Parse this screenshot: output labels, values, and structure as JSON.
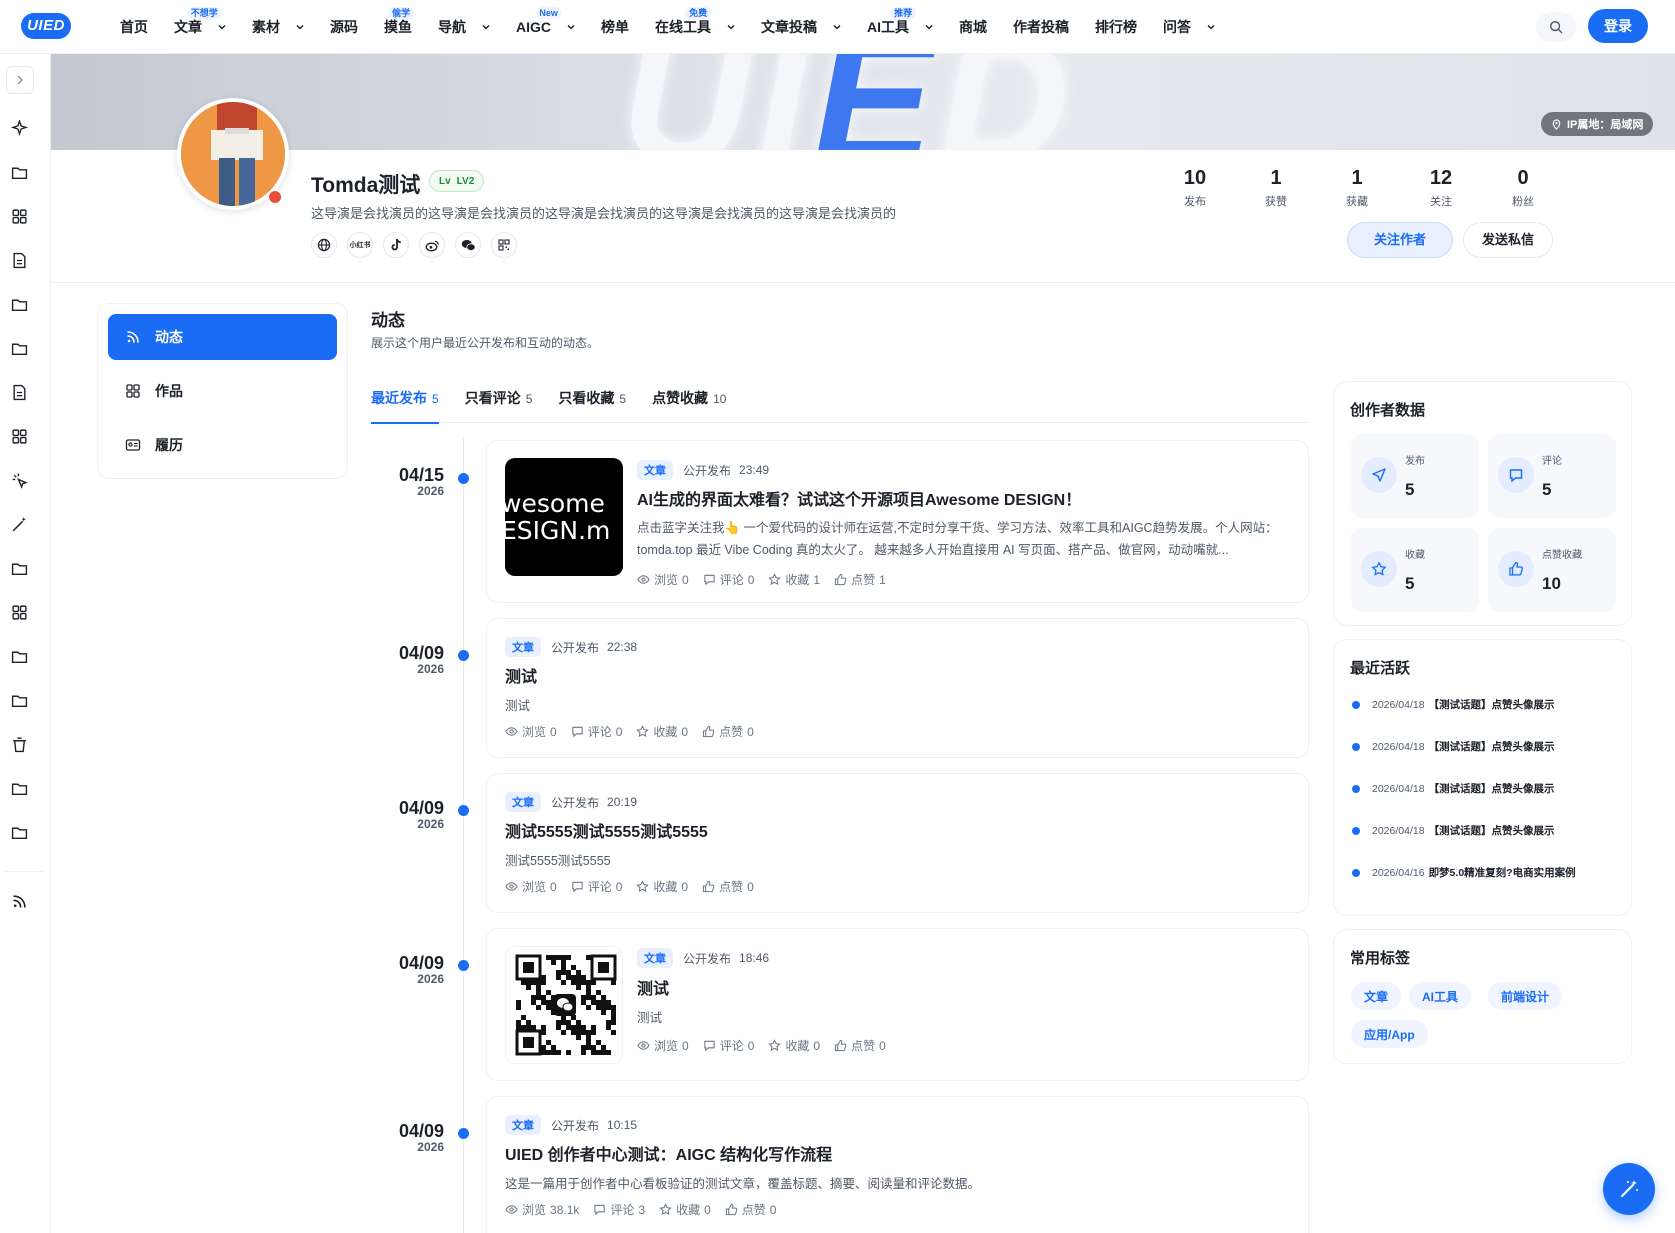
{
  "header": {
    "logo": "UIED",
    "nav": [
      {
        "label": "首页",
        "badge": "",
        "dropdown": false
      },
      {
        "label": "文章",
        "badge": "不想学",
        "dropdown": true
      },
      {
        "label": "素材",
        "badge": "",
        "dropdown": true
      },
      {
        "label": "源码",
        "badge": "",
        "dropdown": false
      },
      {
        "label": "摸鱼",
        "badge": "偷学",
        "dropdown": false
      },
      {
        "label": "导航",
        "badge": "",
        "dropdown": true
      },
      {
        "label": "AIGC",
        "badge": "New",
        "dropdown": true
      },
      {
        "label": "榜单",
        "badge": "",
        "dropdown": false
      },
      {
        "label": "在线工具",
        "badge": "免费",
        "dropdown": true
      },
      {
        "label": "文章投稿",
        "badge": "",
        "dropdown": true
      },
      {
        "label": "AI工具",
        "badge": "推荐",
        "dropdown": true
      },
      {
        "label": "商城",
        "badge": "",
        "dropdown": false
      },
      {
        "label": "作者投稿",
        "badge": "",
        "dropdown": false
      },
      {
        "label": "排行榜",
        "badge": "",
        "dropdown": false
      },
      {
        "label": "问答",
        "badge": "",
        "dropdown": true
      }
    ],
    "login_label": "登录"
  },
  "banner": {
    "word_left": "UI",
    "word_mid": "E",
    "word_right": "D",
    "ip_label": "IP属地：局域网"
  },
  "profile": {
    "name": "Tomda测试",
    "level_prefix": "Lv",
    "level": "LV2",
    "bio": "这导演是会找演员的这导演是会找演员的这导演是会找演员的这导演是会找演员的这导演是会找演员的",
    "social_xhs": "小红书",
    "stats": [
      {
        "value": "10",
        "label": "发布"
      },
      {
        "value": "1",
        "label": "获赞"
      },
      {
        "value": "1",
        "label": "获藏"
      },
      {
        "value": "12",
        "label": "关注"
      },
      {
        "value": "0",
        "label": "粉丝"
      }
    ],
    "follow_label": "关注作者",
    "message_label": "发送私信"
  },
  "side_menu": {
    "items": [
      {
        "label": "动态",
        "icon": "rss-icon",
        "active": true
      },
      {
        "label": "作品",
        "icon": "grid-icon",
        "active": false
      },
      {
        "label": "履历",
        "icon": "id-card-icon",
        "active": false
      }
    ]
  },
  "main": {
    "title": "动态",
    "subtitle": "展示这个用户最近公开发布和互动的动态。",
    "tabs": [
      {
        "label": "最近发布",
        "count": "5",
        "active": true
      },
      {
        "label": "只看评论",
        "count": "5",
        "active": false
      },
      {
        "label": "只看收藏",
        "count": "5",
        "active": false
      },
      {
        "label": "点赞收藏",
        "count": "10",
        "active": false
      }
    ],
    "feed": [
      {
        "date": "04/15",
        "year": "2026",
        "tag": "文章",
        "pub": "公开发布",
        "time": "23:49",
        "title": "AI生成的界面太难看？试试这个开源项目Awesome DESIGN！",
        "excerpt": "点击蓝字关注我👆 一个爱代码的设计师在运营,不定时分享干货、学习方法、效率工具和AIGC趋势发展。个人网站：tomda.top 最近 Vibe Coding 真的太火了。 越来越多人开始直接用 AI 写页面、搭产品、做官网，动动嘴就...",
        "thumb": "awesome",
        "thumb_text_1": "wesome",
        "thumb_text_2": "ESIGN.m",
        "views": "0",
        "comments": "0",
        "favs": "1",
        "likes": "1"
      },
      {
        "date": "04/09",
        "year": "2026",
        "tag": "文章",
        "pub": "公开发布",
        "time": "22:38",
        "title": "测试",
        "excerpt": "测试",
        "thumb": "",
        "views": "0",
        "comments": "0",
        "favs": "0",
        "likes": "0"
      },
      {
        "date": "04/09",
        "year": "2026",
        "tag": "文章",
        "pub": "公开发布",
        "time": "20:19",
        "title": "测试5555测试5555测试5555",
        "excerpt": "测试5555测试5555",
        "thumb": "",
        "views": "0",
        "comments": "0",
        "favs": "0",
        "likes": "0"
      },
      {
        "date": "04/09",
        "year": "2026",
        "tag": "文章",
        "pub": "公开发布",
        "time": "18:46",
        "title": "测试",
        "excerpt": "测试",
        "thumb": "qr",
        "views": "0",
        "comments": "0",
        "favs": "0",
        "likes": "0"
      },
      {
        "date": "04/09",
        "year": "2026",
        "tag": "文章",
        "pub": "公开发布",
        "time": "10:15",
        "title": "UIED 创作者中心测试：AIGC 结构化写作流程",
        "excerpt": "这是一篇用于创作者中心看板验证的测试文章，覆盖标题、摘要、阅读量和评论数据。",
        "thumb": "",
        "views": "38.1k",
        "comments": "3",
        "favs": "0",
        "likes": "0"
      }
    ],
    "stat_labels": {
      "views": "浏览",
      "comments": "评论",
      "favs": "收藏",
      "likes": "点赞"
    }
  },
  "creator_data": {
    "title": "创作者数据",
    "items": [
      {
        "label": "发布",
        "value": "5",
        "icon": "send-icon"
      },
      {
        "label": "评论",
        "value": "5",
        "icon": "comment-icon"
      },
      {
        "label": "收藏",
        "value": "5",
        "icon": "star-icon"
      },
      {
        "label": "点赞收藏",
        "value": "10",
        "icon": "thumb-up-icon"
      }
    ]
  },
  "recent_activity": {
    "title": "最近活跃",
    "items": [
      {
        "date": "2026/04/18",
        "text": "【测试话题】点赞头像展示"
      },
      {
        "date": "2026/04/18",
        "text": "【测试话题】点赞头像展示"
      },
      {
        "date": "2026/04/18",
        "text": "【测试话题】点赞头像展示"
      },
      {
        "date": "2026/04/18",
        "text": "【测试话题】点赞头像展示"
      },
      {
        "date": "2026/04/16",
        "text": "即梦5.0精准复刻?电商实用案例"
      }
    ]
  },
  "tags": {
    "title": "常用标签",
    "items": [
      "文章",
      "AI工具",
      "前端设计",
      "应用/App"
    ]
  },
  "colors": {
    "accent": "#1a6cf5",
    "text": "#1d2129",
    "muted": "#4e5969"
  }
}
